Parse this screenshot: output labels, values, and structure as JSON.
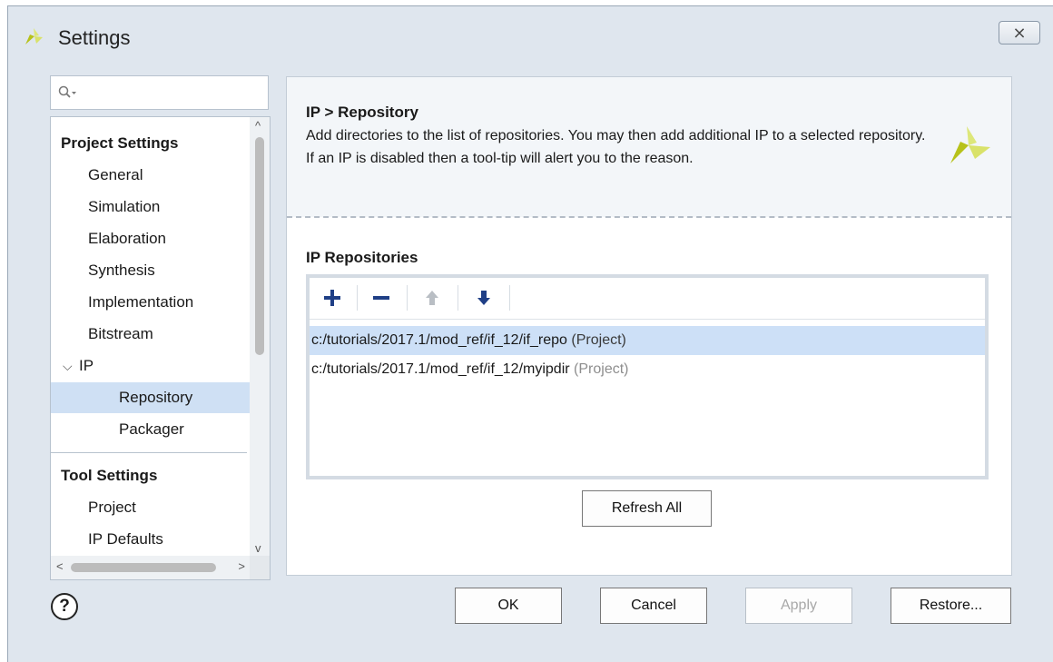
{
  "window": {
    "title": "Settings",
    "close_glyph": "⨯"
  },
  "search": {
    "icon": "search-icon"
  },
  "nav": {
    "sections": [
      {
        "label": "Project Settings"
      },
      {
        "label": "Tool Settings"
      }
    ],
    "project_items": [
      {
        "label": "General"
      },
      {
        "label": "Simulation"
      },
      {
        "label": "Elaboration"
      },
      {
        "label": "Synthesis"
      },
      {
        "label": "Implementation"
      },
      {
        "label": "Bitstream"
      },
      {
        "label": "IP"
      }
    ],
    "ip_children": [
      {
        "label": "Repository",
        "selected": true
      },
      {
        "label": "Packager"
      }
    ],
    "tool_items": [
      {
        "label": "Project"
      },
      {
        "label": "IP Defaults"
      }
    ],
    "expand_glyph": "⌵"
  },
  "panel": {
    "breadcrumb": "IP > Repository",
    "description": "Add directories to the list of repositories. You may then add additional IP to a selected repository. If an IP is disabled then a tool-tip will alert you to the reason.",
    "section_title": "IP Repositories",
    "toolbar": {
      "add": "add-icon",
      "remove": "remove-icon",
      "move_up": "move-up-icon",
      "move_down": "move-down-icon"
    },
    "repositories": [
      {
        "path": "c:/tutorials/2017.1/mod_ref/if_12/if_repo",
        "tag": "(Project)",
        "selected": true
      },
      {
        "path": "c:/tutorials/2017.1/mod_ref/if_12/myipdir",
        "tag": "(Project)",
        "selected": false
      }
    ],
    "refresh_label": "Refresh All"
  },
  "footer": {
    "help_glyph": "?",
    "ok_label": "OK",
    "cancel_label": "Cancel",
    "apply_label": "Apply",
    "restore_label": "Restore..."
  },
  "colors": {
    "selection": "#cde0f7",
    "brand_green": "#b7c21a",
    "brand_light": "#dde77a",
    "dialog_bg": "#dfe6ee"
  }
}
